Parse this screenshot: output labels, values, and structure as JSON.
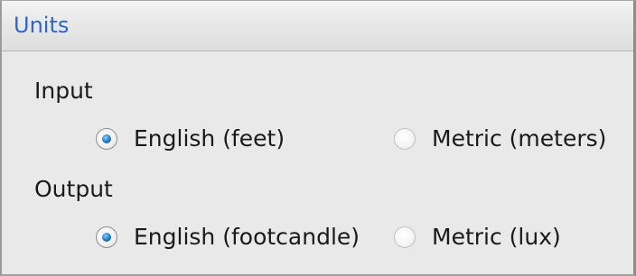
{
  "panel": {
    "title": "Units"
  },
  "input": {
    "label": "Input",
    "options": [
      {
        "label": "English (feet)",
        "checked": true
      },
      {
        "label": "Metric (meters)",
        "checked": false
      }
    ]
  },
  "output": {
    "label": "Output",
    "options": [
      {
        "label": "English (footcandle)",
        "checked": true
      },
      {
        "label": "Metric (lux)",
        "checked": false
      }
    ]
  }
}
